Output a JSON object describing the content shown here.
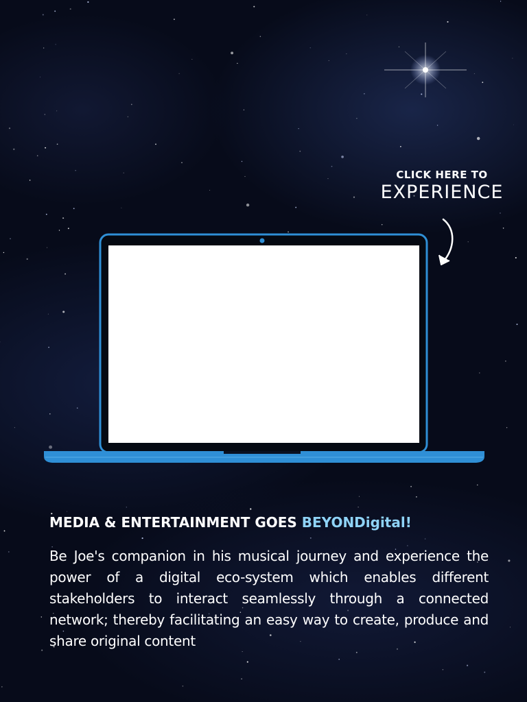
{
  "cta": {
    "small_label": "CLICK HERE TO",
    "big_label": "EXPERIENCE"
  },
  "headline": {
    "prefix": "MEDIA & ENTERTAINMENT GOES ",
    "highlight": "BEYONDigital!"
  },
  "body": {
    "text": "Be Joe's companion in his musical journey and experience the power of a digital eco-system which enables different stakeholders to interact seamlessly through a connected network; thereby facilitating an easy way to create, produce and share original content"
  },
  "colors": {
    "background": "#070b1a",
    "laptop_outline": "#2f8fd6",
    "accent_text": "#8fd3f7",
    "screen": "#ffffff"
  },
  "icons": {
    "cta_arrow": "curved-arrow-down-icon",
    "laptop": "laptop-icon"
  }
}
